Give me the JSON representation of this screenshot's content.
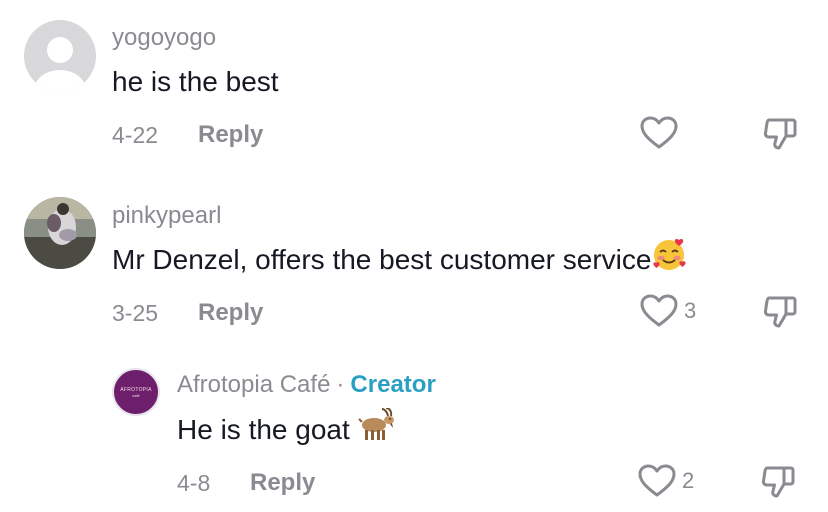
{
  "comments": [
    {
      "username": "yogoyogo",
      "text": "he is the best",
      "date": "4-22",
      "reply_label": "Reply",
      "like_count": "",
      "avatar": "default-avatar-icon"
    },
    {
      "username": "pinkypearl",
      "text": "Mr Denzel, offers the best customer service",
      "emoji": "smiling-face-with-hearts-icon",
      "date": "3-25",
      "reply_label": "Reply",
      "like_count": "3",
      "avatar": "photo-avatar"
    }
  ],
  "reply": {
    "username": "Afrotopia Café",
    "separator": "·",
    "creator_label": "Creator",
    "avatar_text": "AFROTOPIA",
    "avatar_subtext": "café",
    "avatar_color": "#6e1f6c",
    "text": "He is the goat",
    "emoji": "goat-icon",
    "date": "4-8",
    "reply_label": "Reply",
    "like_count": "2"
  },
  "colors": {
    "meta": "#8a8b91",
    "text": "#161823",
    "creator": "#2b9fc3"
  }
}
